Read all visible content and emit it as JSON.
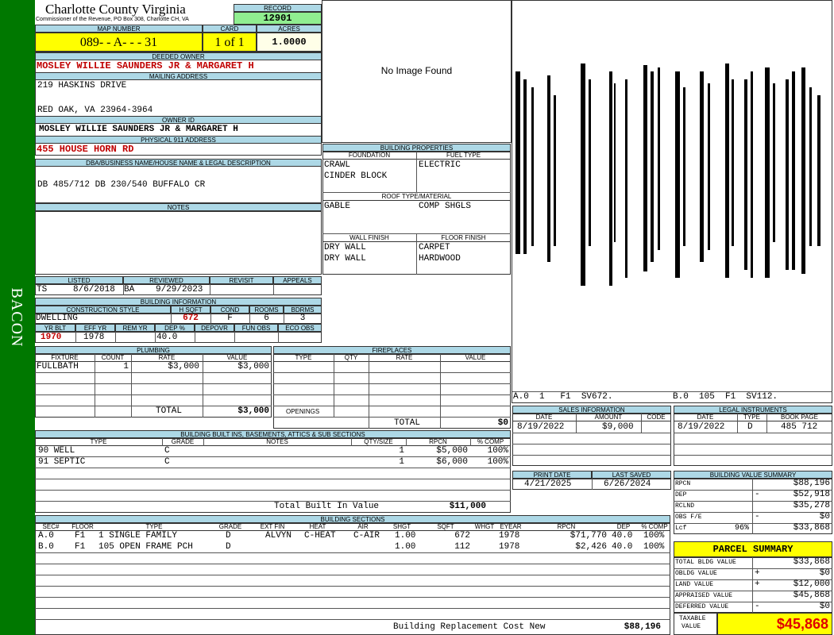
{
  "side_label": "BACON",
  "header": {
    "county": "Charlotte County Virginia",
    "subtitle": "Commissioner of the Revenue, PO Box 308, Charlotte CH, VA",
    "record_label": "RECORD",
    "record": "12901",
    "map_number_label": "MAP NUMBER",
    "map_number": "089- - A- - - 31",
    "card_label": "CARD",
    "card": "1 of 1",
    "acres_label": "ACRES",
    "acres": "1.0000"
  },
  "owner": {
    "deeded_label": "DEEDED OWNER",
    "deeded_owner": "MOSLEY WILLIE SAUNDERS JR & MARGARET H",
    "mailing_label": "MAILING ADDRESS",
    "address1": "219 HASKINS DRIVE",
    "address2": "RED OAK, VA 23964-3964",
    "owner_id_label": "OWNER ID",
    "owner_id": "MOSLEY WILLIE SAUNDERS JR & MARGARET H",
    "physical_label": "PHYSICAL 911 ADDRESS",
    "physical_address": "455 HOUSE HORN RD",
    "dba_label": "DBA/BUSINESS NAME/HOUSE NAME & LEGAL DESCRIPTION",
    "legal": "DB 485/712 DB 230/540 BUFFALO CR",
    "notes_label": "NOTES"
  },
  "image": {
    "placeholder": "No Image Found"
  },
  "building_properties": {
    "title": "BUILDING PROPERTIES",
    "foundation_label": "FOUNDATION",
    "foundation": [
      "CRAWL",
      "CINDER BLOCK"
    ],
    "fuel_label": "FUEL TYPE",
    "fuel": "ELECTRIC",
    "roof_label": "ROOF TYPE/MATERIAL",
    "roof_type": "GABLE",
    "roof_material": "COMP SHGLS",
    "wall_label": "WALL FINISH",
    "wall": [
      "DRY WALL",
      "DRY WALL"
    ],
    "floor_label": "FLOOR FINISH",
    "floor": [
      "CARPET",
      "HARDWOOD"
    ]
  },
  "sketch": {
    "label_a": "A.0  1   F1  SV672.",
    "label_b": "B.0  105  F1  SV112."
  },
  "listed": {
    "listed_label": "LISTED",
    "reviewed_label": "REVIEWED",
    "revisit_label": "REVISIT",
    "appeals_label": "APPEALS",
    "listed_by": "TS",
    "listed_date": "8/6/2018",
    "reviewed_by": "BA",
    "reviewed_date": "9/29/2023"
  },
  "building_info": {
    "title": "BUILDING INFORMATION",
    "style_label": "CONSTRUCTION STYLE",
    "hsqft_label": "H SQFT",
    "cond_label": "COND",
    "rooms_label": "ROOMS",
    "bdrms_label": "BDRMS",
    "style": "DWELLING",
    "hsqft": "672",
    "cond": "F",
    "rooms": "6",
    "bdrms": "3",
    "yrblt_label": "YR BLT",
    "effyr_label": "EFF YR",
    "remyr_label": "REM YR",
    "dep_label": "DEP %",
    "depovr_label": "DEPOVR",
    "funobs_label": "FUN OBS",
    "ecoobs_label": "ECO OBS",
    "yrblt": "1970",
    "effyr": "1978",
    "dep": "40.0"
  },
  "plumbing": {
    "title": "PLUMBING",
    "headers": [
      "FIXTURE",
      "COUNT",
      "RATE",
      "VALUE"
    ],
    "rows": [
      {
        "fixture": "FULLBATH",
        "count": "1",
        "rate": "$3,000",
        "value": "$3,000"
      }
    ],
    "total_label": "TOTAL",
    "total": "$3,000"
  },
  "fireplaces": {
    "title": "FIREPLACES",
    "headers": [
      "TYPE",
      "QTY",
      "RATE",
      "VALUE"
    ],
    "openings_label": "OPENINGS",
    "total_label": "TOTAL",
    "total": "$0"
  },
  "sales": {
    "title": "SALES INFORMATION",
    "headers": [
      "DATE",
      "AMOUNT",
      "CODE"
    ],
    "date": "8/19/2022",
    "amount": "$9,000"
  },
  "legal_instruments": {
    "title": "LEGAL INSTRUMENTS",
    "headers": [
      "DATE",
      "TYPE",
      "BOOK PAGE"
    ],
    "date": "8/19/2022",
    "type": "D",
    "bookpage": "485 712"
  },
  "built_ins": {
    "title": "BUILDING BUILT INS, BASEMENTS, ATTICS & SUB SECTIONS",
    "headers": [
      "TYPE",
      "GRADE",
      "NOTES",
      "QTY/SIZE",
      "RPCN",
      "% COMP"
    ],
    "rows": [
      {
        "type": "90 WELL",
        "grade": "C",
        "qty": "1",
        "rpcn": "$5,000",
        "comp": "100%"
      },
      {
        "type": "91 SEPTIC",
        "grade": "C",
        "qty": "1",
        "rpcn": "$6,000",
        "comp": "100%"
      }
    ],
    "total_label": "Total Built In Value",
    "total": "$11,000"
  },
  "dates": {
    "print_label": "PRINT DATE",
    "saved_label": "LAST SAVED",
    "print_date": "4/21/2025",
    "last_saved": "6/26/2024"
  },
  "value_summary": {
    "title": "BUILDING VALUE SUMMARY",
    "rpcn_label": "RPCN",
    "rpcn": "$88,196",
    "dep_label": "DEP",
    "dep_sign": "-",
    "dep": "$52,918",
    "rclnd_label": "RCLND",
    "rclnd": "$35,278",
    "obs_label": "OBS F/E",
    "obs_sign": "-",
    "obs": "$0",
    "lcf_label": "Lcf",
    "lcf_pct": "96%",
    "lcf": "$33,868"
  },
  "sections": {
    "title": "BUILDING SECTIONS",
    "headers": [
      "SEC#",
      "FLOOR",
      "TYPE",
      "GRADE",
      "EXT FIN",
      "HEAT",
      "AIR",
      "SHGT",
      "SQFT",
      "WHGT",
      "EYEAR",
      "RPCN",
      "DEP",
      "% COMP"
    ],
    "rows": [
      {
        "sec": "A.0",
        "floor": "F1",
        "type": "1 SINGLE FAMILY",
        "grade": "D",
        "ext": "ALVYN",
        "heat": "C-HEAT",
        "air": "C-AIR",
        "shgt": "1.00",
        "sqft": "672",
        "eyear": "1978",
        "rpcn": "$71,770",
        "dep": "40.0",
        "comp": "100%"
      },
      {
        "sec": "B.0",
        "floor": "F1",
        "type": "105 OPEN FRAME PCH",
        "grade": "D",
        "ext": "",
        "heat": "",
        "air": "",
        "shgt": "1.00",
        "sqft": "112",
        "eyear": "1978",
        "rpcn": "$2,426",
        "dep": "40.0",
        "comp": "100%"
      }
    ],
    "replacement_label": "Building Replacement Cost New",
    "replacement": "$88,196"
  },
  "parcel_summary": {
    "title": "PARCEL SUMMARY",
    "bldg_label": "TOTAL BLDG VALUE",
    "bldg": "$33,868",
    "obldg_label": "OBLDG VALUE",
    "obldg_sign": "+",
    "obldg": "$0",
    "land_label": "LAND VALUE",
    "land_sign": "+",
    "land": "$12,000",
    "appraised_label": "APPRAISED VALUE",
    "appraised": "$45,868",
    "deferred_label": "DEFERRED VALUE",
    "deferred_sign": "-",
    "deferred": "$0",
    "taxable_label1": "TAXABLE",
    "taxable_label2": "VALUE",
    "taxable": "$45,868"
  },
  "colors": {
    "side_bar": "#007800",
    "header_bar": "#add8e6",
    "highlight": "#ffff00",
    "record_bg": "#90ee90",
    "red_text": "#c00000"
  }
}
